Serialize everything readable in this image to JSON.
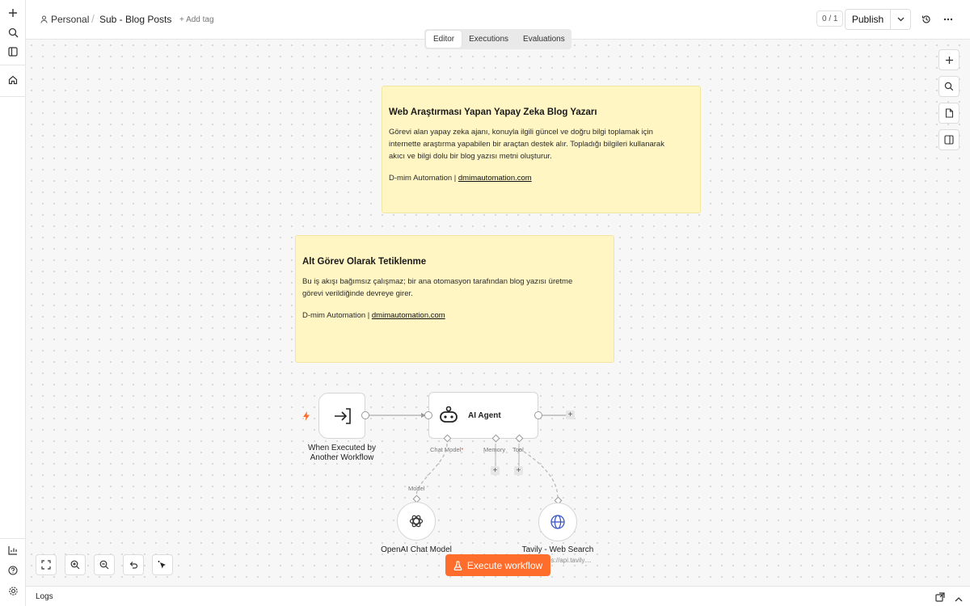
{
  "breadcrumb": {
    "project": "Personal",
    "separator": "/",
    "workflow_name": "Sub - Blog Posts",
    "add_tag": "+ Add tag"
  },
  "header": {
    "version_counter": "0 / 1",
    "publish_label": "Publish"
  },
  "tabs": [
    {
      "label": "Editor",
      "active": true
    },
    {
      "label": "Executions",
      "active": false
    },
    {
      "label": "Evaluations",
      "active": false
    }
  ],
  "sticky_notes": [
    {
      "title": "Web Araştırması Yapan Yapay Zeka Blog Yazarı",
      "lines": [
        "Görevi alan yapay zeka ajanı, konuyla ilgili güncel ve doğru bilgi toplamak için",
        "internette araştırma yapabilen bir araçtan destek alır. Topladığı bilgileri kullanarak",
        "akıcı ve bilgi dolu bir blog yazısı metni oluşturur."
      ],
      "footer_text": "D-mim Automation | ",
      "footer_link": "dmimautomation.com"
    },
    {
      "title": "Alt Görev Olarak Tetiklenme",
      "lines": [
        "Bu iş akışı bağımsız çalışmaz; bir ana otomasyon tarafından blog yazısı üretme",
        "görevi verildiğinde devreye girer."
      ],
      "footer_text": "D-mim Automation | ",
      "footer_link": "dmimautomation.com"
    }
  ],
  "nodes": {
    "trigger": {
      "line1": "When Executed by",
      "line2": "Another Workflow"
    },
    "agent": {
      "label": "AI Agent",
      "handles": {
        "chat_model": "Chat Model",
        "required_mark": "*",
        "memory": "Memory",
        "tool": "Tool"
      }
    },
    "openai": {
      "label": "OpenAI Chat Model",
      "input_label": "Model"
    },
    "tavily": {
      "label": "Tavily - Web Search",
      "subtitle": "https://api.tavily...."
    }
  },
  "execute_button": "Execute workflow",
  "logs_label": "Logs",
  "colors": {
    "accent": "#ff6d2d",
    "sticky_bg": "#fff6c4",
    "canvas_bg": "#f7f7f7",
    "openai_icon": "#333333",
    "tavily_icon": "#3a57c4"
  }
}
